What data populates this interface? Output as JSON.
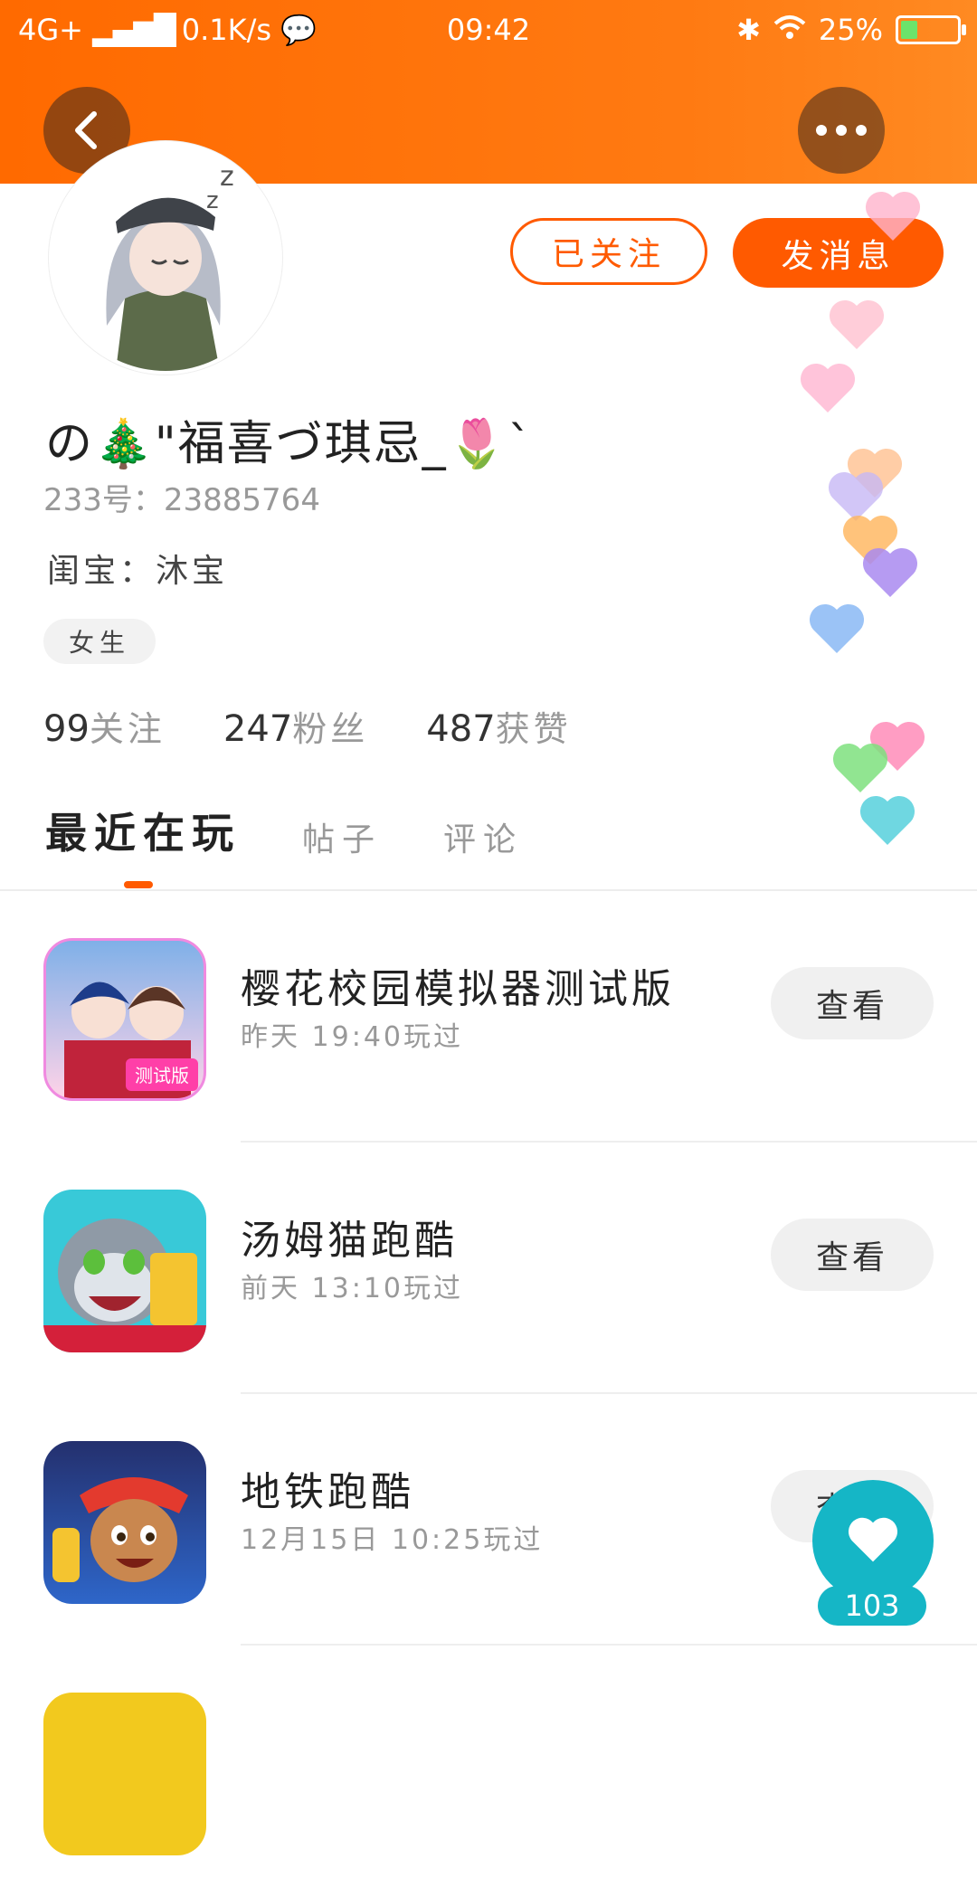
{
  "status_bar": {
    "network": "4G+",
    "speed": "0.1K/s",
    "time": "09:42",
    "battery": "25%"
  },
  "header": {
    "back_icon": "chevron-left-icon",
    "more_icon": "more-dots-icon"
  },
  "profile": {
    "username": "の🎄\"福喜づ琪忌_🌷`",
    "uid": "233号：23885764",
    "guild": "闺宝：沐宝",
    "gender_tag": "女生",
    "follow_button": "已关注",
    "message_button": "发消息",
    "stats": [
      {
        "value": "99",
        "label": "关注"
      },
      {
        "value": "247",
        "label": "粉丝"
      },
      {
        "value": "487",
        "label": "获赞"
      }
    ]
  },
  "tabs": [
    {
      "label": "最近在玩",
      "active": true
    },
    {
      "label": "帖子",
      "active": false
    },
    {
      "label": "评论",
      "active": false
    }
  ],
  "games": [
    {
      "title": "樱花校园模拟器测试版",
      "time": "昨天 19:40玩过",
      "button": "查看",
      "icon": "sakura-school-game-icon",
      "badge": "测试版"
    },
    {
      "title": "汤姆猫跑酷",
      "time": "前天 13:10玩过",
      "button": "查看",
      "icon": "tom-cat-runner-game-icon"
    },
    {
      "title": "地铁跑酷",
      "time": "12月15日 10:25玩过",
      "button": "查看",
      "icon": "subway-surfers-game-icon"
    }
  ],
  "like": {
    "count": "103",
    "icon": "heart-icon"
  },
  "colors": {
    "accent": "#ff5a00",
    "header": "#ff7a12",
    "like": "#15b6c6"
  }
}
